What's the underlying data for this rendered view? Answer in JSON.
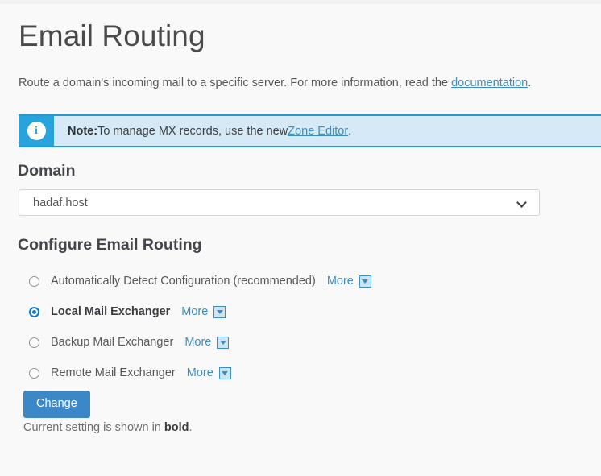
{
  "page": {
    "title": "Email Routing",
    "intro_before_link": "Route a domain's incoming mail to a specific server. For more information, read the ",
    "intro_link": "documentation",
    "intro_after_link": "."
  },
  "notice": {
    "icon": "info-circle-icon",
    "icon_glyph": "i",
    "label": "Note:",
    "text_before_link": " To manage MX records, use the new ",
    "link": "Zone Editor",
    "text_after_link": "."
  },
  "domain": {
    "heading": "Domain",
    "selected": "hadaf.host",
    "options": [
      "hadaf.host"
    ],
    "chevron_icon": "chevron-down-icon"
  },
  "configure": {
    "heading": "Configure Email Routing",
    "more_label": "More",
    "caret_icon": "caret-down-icon",
    "options": [
      {
        "label": "Automatically Detect Configuration (recommended)",
        "selected": false
      },
      {
        "label": "Local Mail Exchanger",
        "selected": true
      },
      {
        "label": "Backup Mail Exchanger",
        "selected": false
      },
      {
        "label": "Remote Mail Exchanger",
        "selected": false
      }
    ]
  },
  "actions": {
    "change_label": "Change",
    "footnote_before": "Current setting is shown in ",
    "footnote_bold": "bold",
    "footnote_after": "."
  },
  "colors": {
    "accent_blue": "#3d8ec1",
    "notice_bg": "#d5e9f7",
    "notice_border": "#1f9bd4",
    "notice_icon_bg": "#29a3de",
    "button_blue": "#3b87c8",
    "page_bg": "#f9f9f9"
  }
}
